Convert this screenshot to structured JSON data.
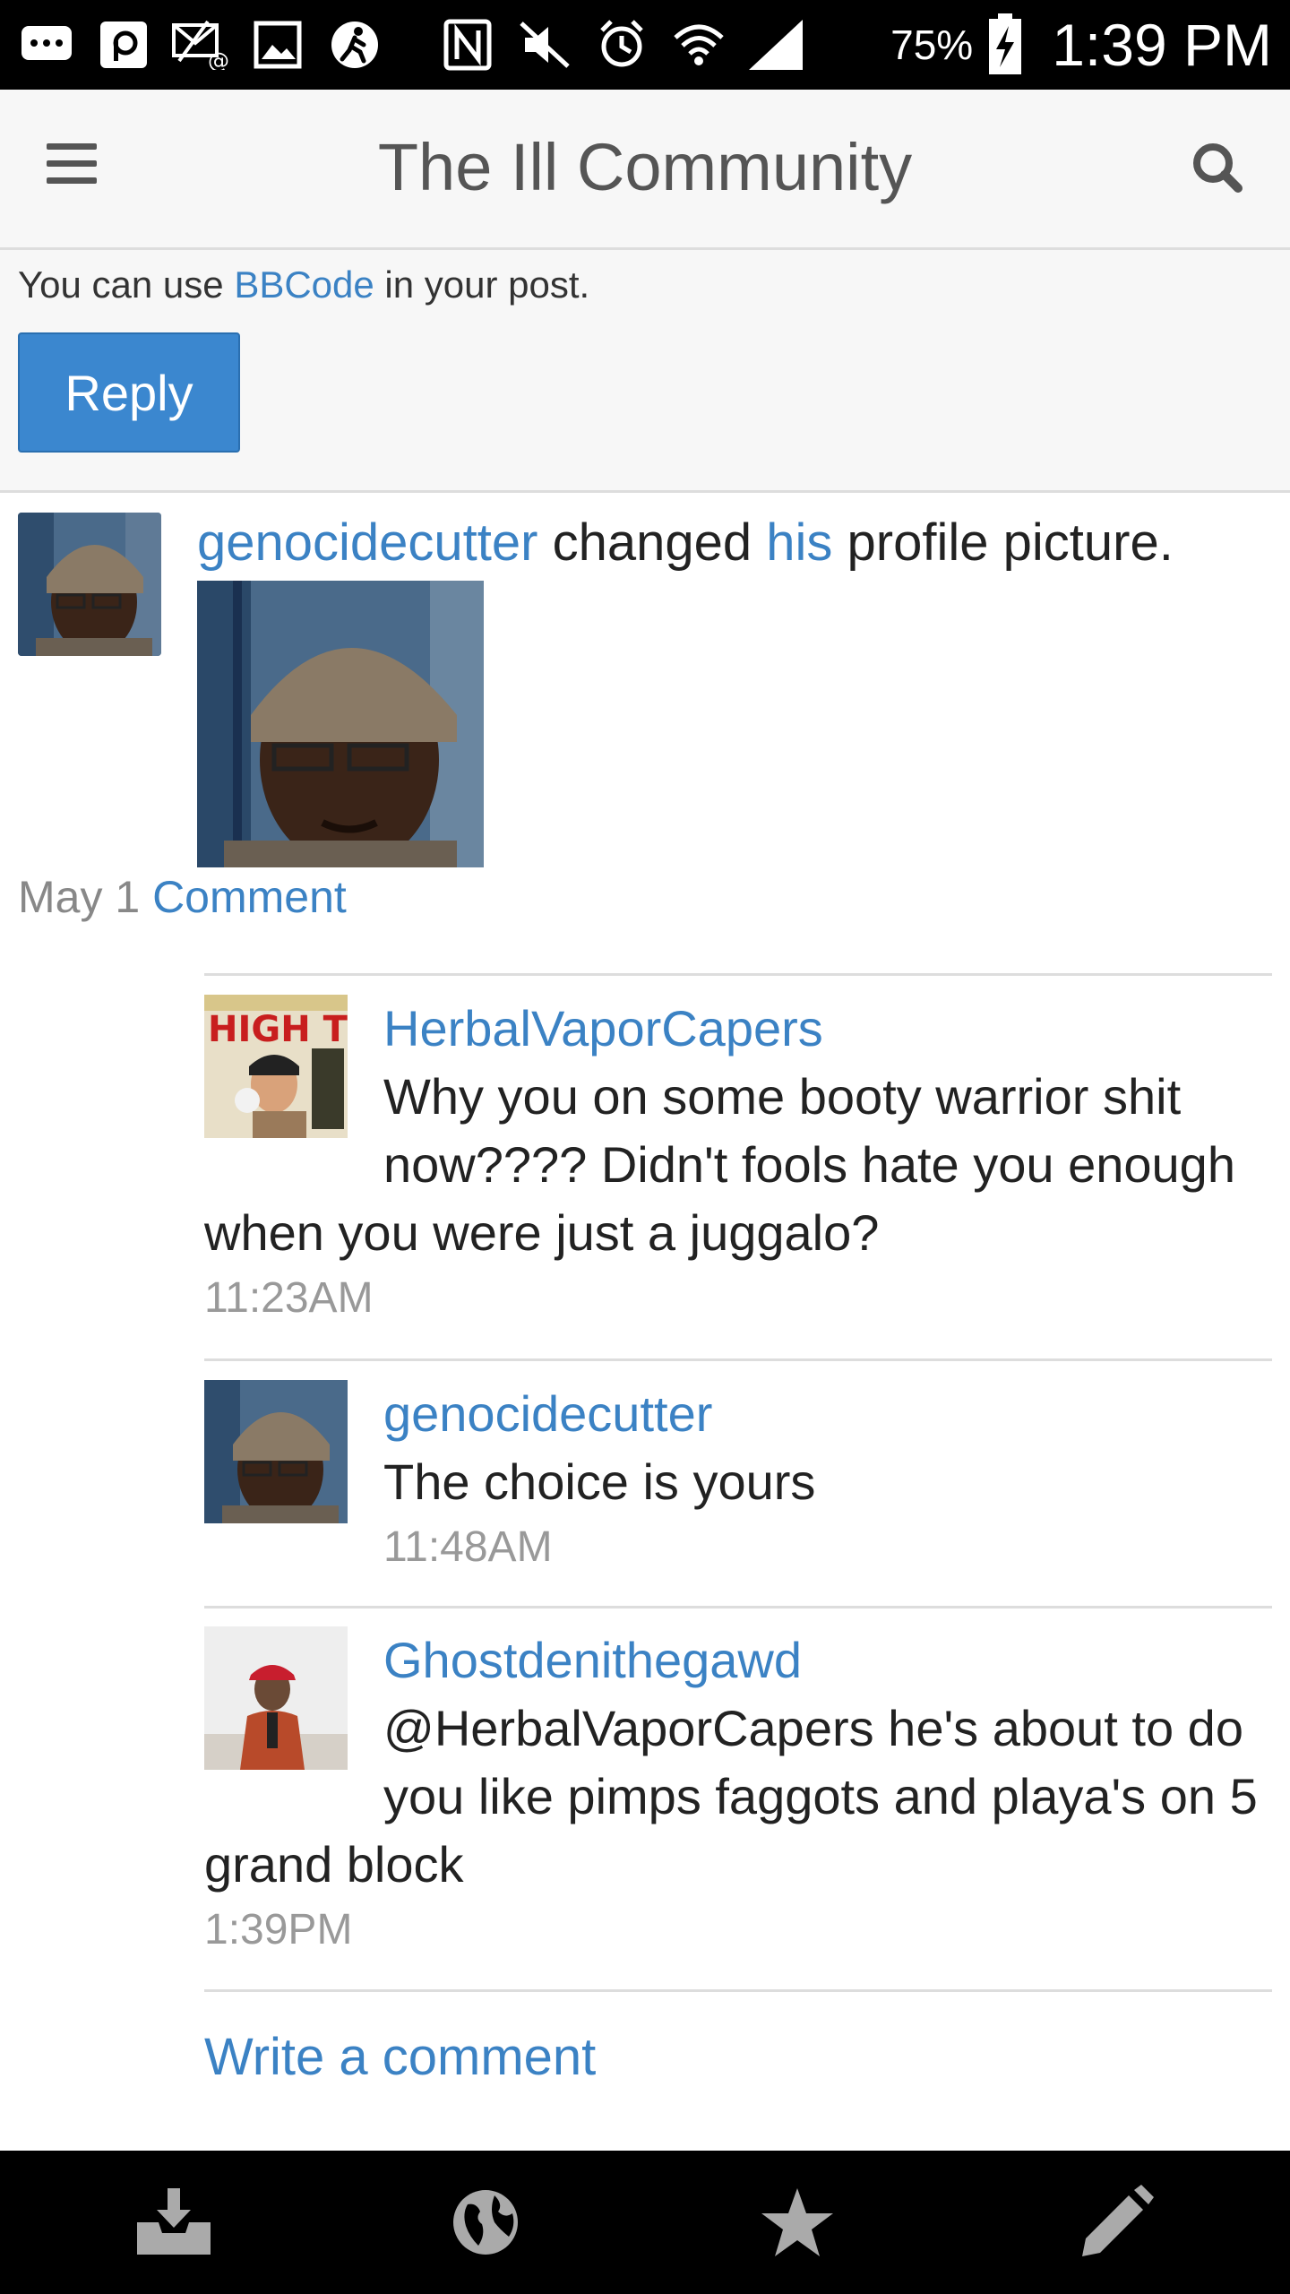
{
  "status_bar": {
    "battery": "75%",
    "time": "1:39 PM",
    "icons": [
      "message-icon",
      "p-app-icon",
      "mail-icon",
      "gallery-icon",
      "runner-icon",
      "nfc-icon",
      "mute-icon",
      "alarm-icon",
      "wifi-icon",
      "signal-icon",
      "battery-charging-icon"
    ]
  },
  "header": {
    "title": "The Ill Community",
    "menu_icon": "hamburger-icon",
    "search_icon": "search-icon"
  },
  "reply_area": {
    "note_prefix": "You can use ",
    "note_link": "BBCode",
    "note_suffix": " in your post.",
    "reply_label": "Reply"
  },
  "post": {
    "author": "genocidecutter",
    "action_text": " changed ",
    "possessive": "his",
    "action_tail": " profile picture.",
    "date": "May 1",
    "comment_link": "Comment"
  },
  "comments": [
    {
      "author": "HerbalVaporCapers",
      "text": "Why you on some booty warrior shit now???? Didn't fools hate you enough when you were just a juggalo?",
      "time": "11:23AM"
    },
    {
      "author": "genocidecutter",
      "text": "The choice is yours",
      "time": "11:48AM"
    },
    {
      "author": "Ghostdenithegawd",
      "text": "@HerbalVaporCapers he's about to do you like pimps faggots and playa's on 5 grand block",
      "time": "1:39PM"
    }
  ],
  "write_comment": "Write a comment",
  "bottom_nav": {
    "items": [
      "inbox-icon",
      "globe-icon",
      "star-icon",
      "pencil-icon"
    ]
  },
  "colors": {
    "link": "#3b82c4",
    "button": "#3b87cf",
    "header_bg": "#f7f7f7"
  }
}
